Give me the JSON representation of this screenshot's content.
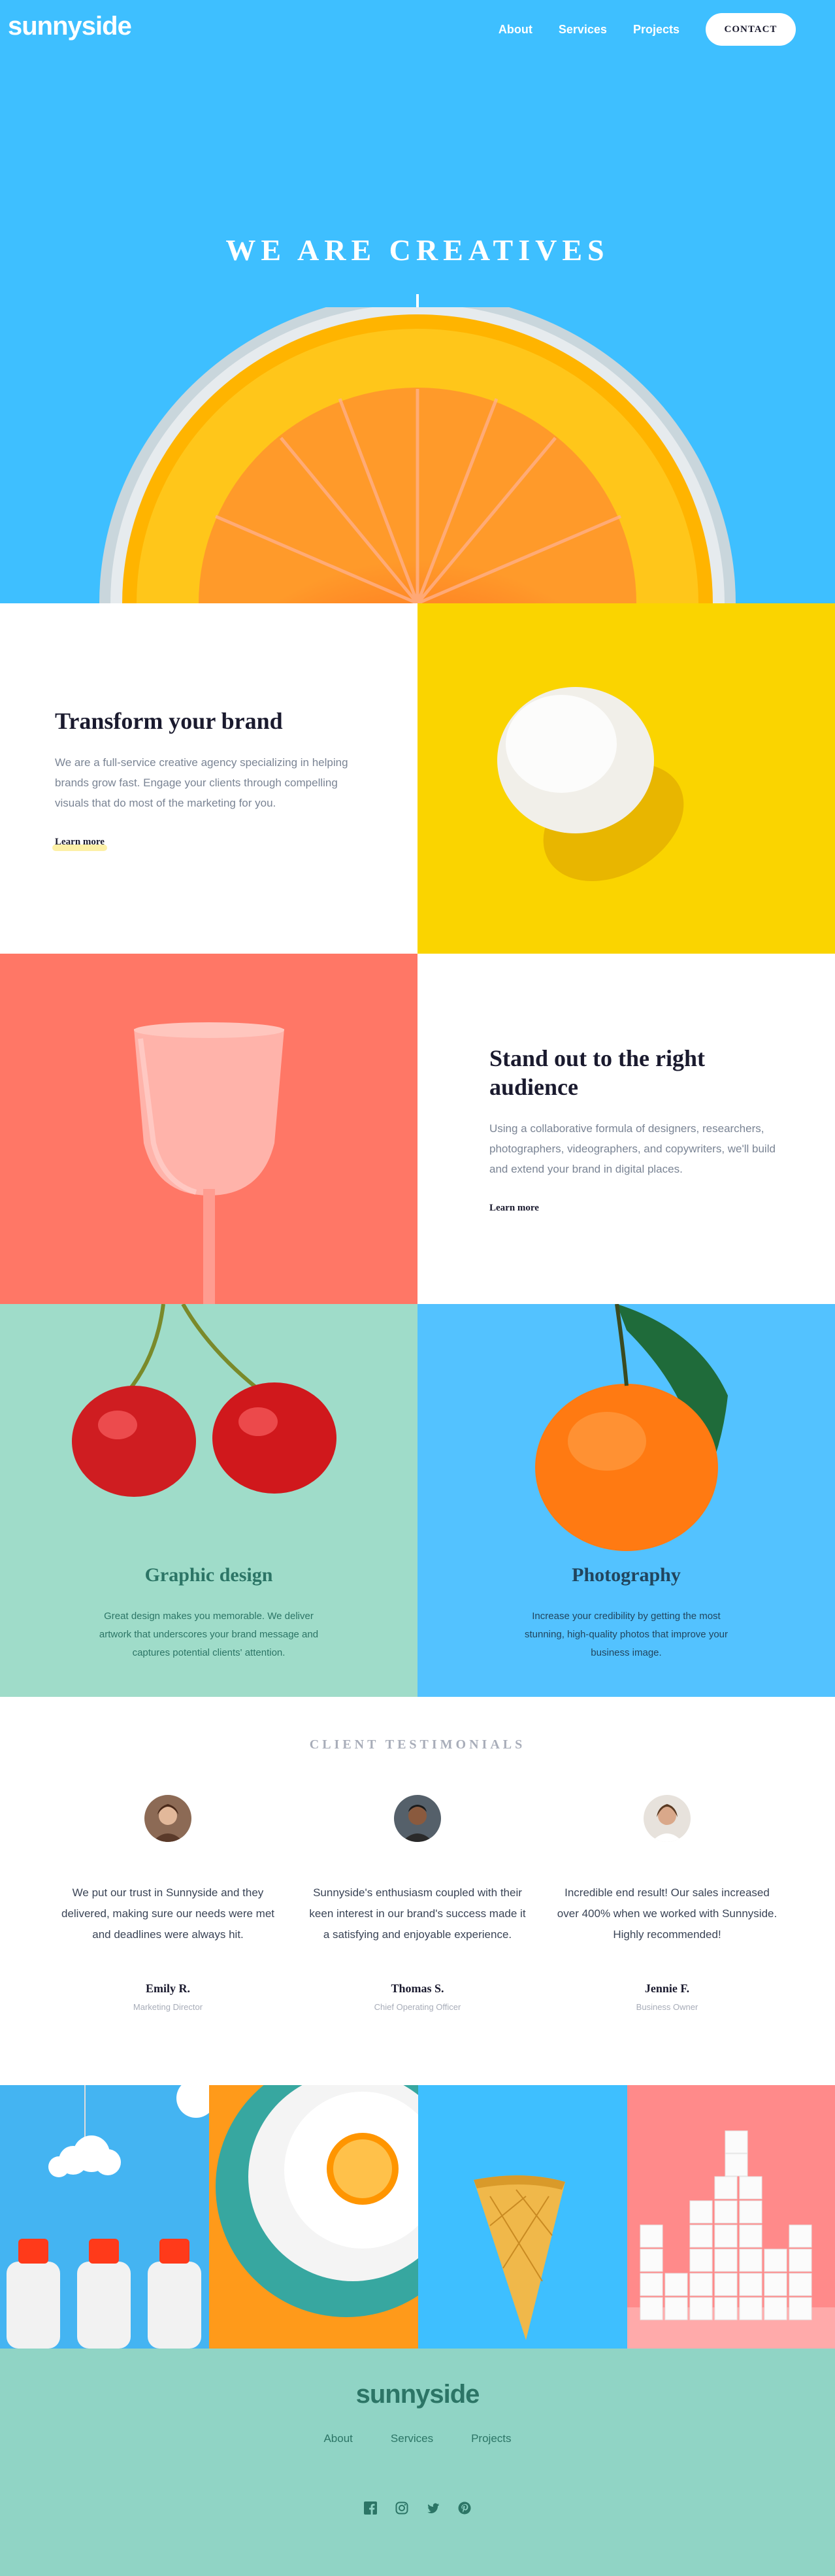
{
  "brand": {
    "logo": "sunnyside"
  },
  "nav": {
    "links": [
      "About",
      "Services",
      "Projects"
    ],
    "contact_label": "CONTACT"
  },
  "hero": {
    "title": "WE ARE CREATIVES",
    "arrow_icon": "arrow-down-icon"
  },
  "features": [
    {
      "title": "Transform your brand",
      "text": "We are a full-service creative agency specializing in helping brands grow fast. Engage your clients through compelling visuals that do most of the marketing for you.",
      "link": "Learn more",
      "accent": "#fad400"
    },
    {
      "title": "Stand out to the right audience",
      "text": "Using a collaborative formula of designers, researchers, photographers, videographers, and copywriters, we'll build and extend your brand in digital places.",
      "link": "Learn more",
      "accent": "#ff7766"
    }
  ],
  "services": [
    {
      "title": "Graphic design",
      "text": "Great design makes you memorable. We deliver artwork that underscores your brand message and captures potential clients' attention.",
      "color": "#2c7566"
    },
    {
      "title": "Photography",
      "text": "Increase your credibility by getting the most stunning, high-quality photos that improve your business image.",
      "color": "#21455e"
    }
  ],
  "testimonials": {
    "heading": "CLIENT TESTIMONIALS",
    "items": [
      {
        "quote": "We put our trust in Sunnyside and they delivered, making sure our needs were met and deadlines were always hit.",
        "name": "Emily R.",
        "role": "Marketing Director"
      },
      {
        "quote": "Sunnyside's enthusiasm coupled with their keen interest in our brand's success made it a satisfying and enjoyable experience.",
        "name": "Thomas S.",
        "role": "Chief Operating Officer"
      },
      {
        "quote": "Incredible end result! Our sales increased over 400% when we worked with Sunnyside. Highly recommended!",
        "name": "Jennie F.",
        "role": "Business Owner"
      }
    ]
  },
  "footer": {
    "logo": "sunnyside",
    "links": [
      "About",
      "Services",
      "Projects"
    ],
    "social_icons": [
      "facebook-icon",
      "instagram-icon",
      "twitter-icon",
      "pinterest-icon"
    ]
  },
  "colors": {
    "hero_bg": "#3ebfff",
    "yellow": "#fad400",
    "coral": "#ff7766",
    "mint": "#90d4c5",
    "footer_text": "#2c7566"
  }
}
